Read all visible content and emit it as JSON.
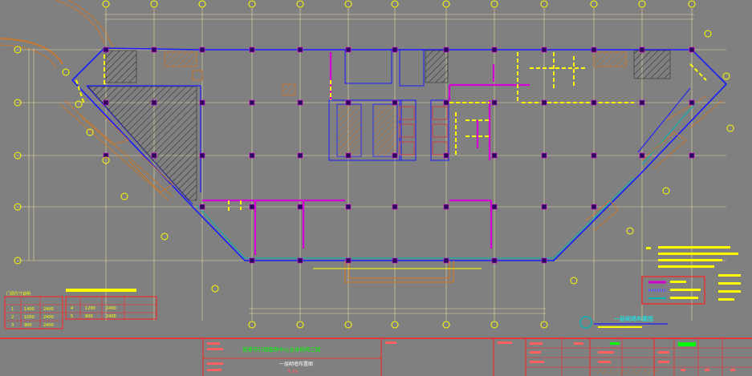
{
  "drawing": {
    "title": "一层砌墙布置图",
    "subtitle": "PLAN",
    "plan_caption": "一层砌墙布置图"
  },
  "table_left": {
    "header": "门洞尺寸说明",
    "rows": [
      {
        "id": "1",
        "w": "1400",
        "h": "2400"
      },
      {
        "id": "2",
        "w": "1000",
        "h": "2400"
      },
      {
        "id": "3",
        "w": "900",
        "h": "2400"
      }
    ],
    "rows_right": [
      {
        "id": "4",
        "w": "1200",
        "h": "2400"
      },
      {
        "id": "5",
        "w": "800",
        "h": "2400"
      }
    ]
  },
  "titleblock": {
    "project_name": "某某市行政服务中心主体结构工程",
    "sheet_name": "一层砌墙布置图",
    "sheet_name_en": "PLAN"
  },
  "colors": {
    "background": "#808080",
    "grid": "#f2e6a0",
    "column": "#2a0a5a",
    "magenta": "#d400d4",
    "yellow": "#ffff00",
    "blue": "#1a1aff",
    "cyan": "#00b3b3",
    "red": "#ff2020",
    "orange": "#c87830",
    "green": "#00ff00",
    "darkgreen": "#006600"
  }
}
